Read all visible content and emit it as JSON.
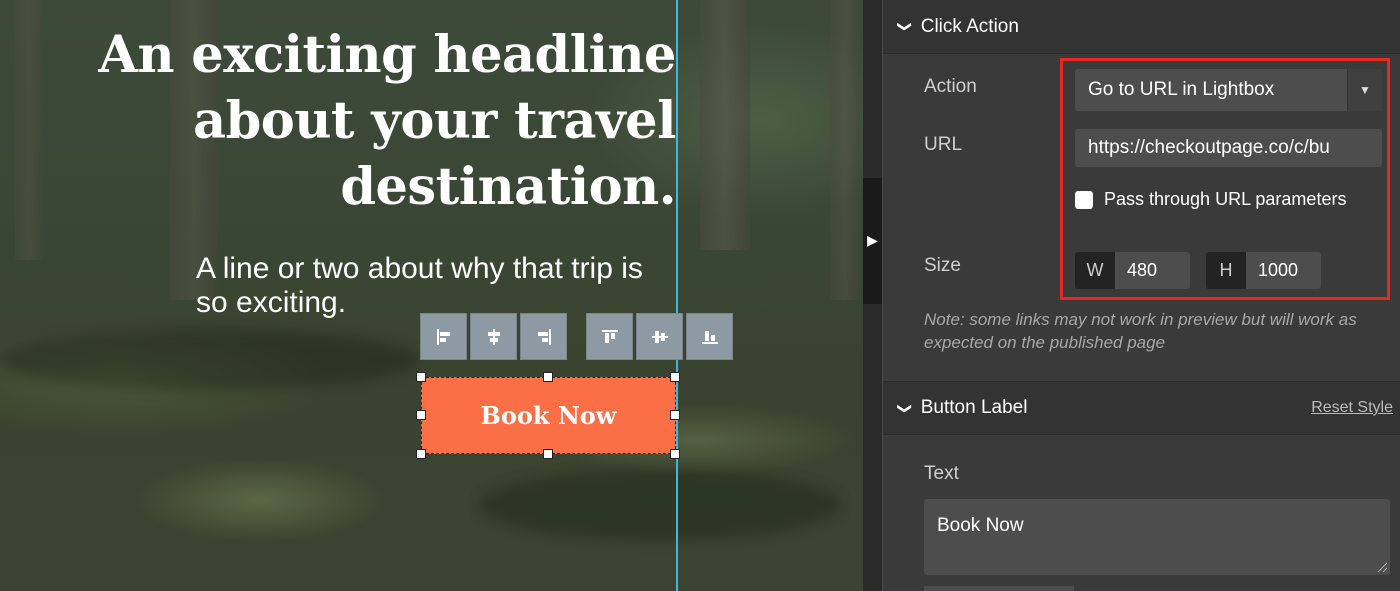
{
  "canvas": {
    "headline": "An exciting headline about your travel destination.",
    "subline": "A line or two about why that trip is so exciting.",
    "button_label": "Book Now",
    "align_tools": [
      {
        "icon": "align-left-icon"
      },
      {
        "icon": "align-center-horizontal-icon"
      },
      {
        "icon": "align-right-icon"
      },
      {
        "icon": "align-top-icon"
      },
      {
        "icon": "align-middle-vertical-icon"
      },
      {
        "icon": "align-bottom-icon"
      }
    ],
    "guide_color": "#3fb6e3",
    "button_color": "#fb6f47"
  },
  "panel": {
    "click_action": {
      "title": "Click Action",
      "action_label": "Action",
      "action_value": "Go to URL in Lightbox",
      "url_label": "URL",
      "url_value": "https://checkoutpage.co/c/bu",
      "passthrough_label": "Pass through URL parameters",
      "passthrough_checked": false,
      "size_label": "Size",
      "width_tag": "W",
      "width_value": "480",
      "height_tag": "H",
      "height_value": "1000",
      "note": "Note: some links may not work in preview but will work as expected on the published page",
      "highlight_color": "#e8281f"
    },
    "button_label_section": {
      "title": "Button Label",
      "reset": "Reset Style",
      "text_label": "Text",
      "text_value": "Book Now"
    }
  }
}
